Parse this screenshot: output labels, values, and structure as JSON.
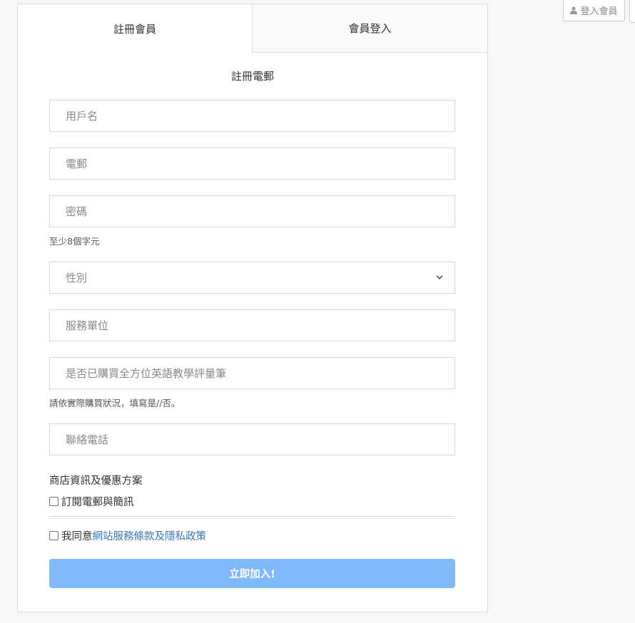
{
  "header": {
    "member_login_label": "登入會員"
  },
  "tabs": [
    {
      "label": "註冊會員",
      "active": true
    },
    {
      "label": "會員登入",
      "active": false
    }
  ],
  "form": {
    "heading": "註冊電郵",
    "username": {
      "placeholder": "用戶名",
      "value": ""
    },
    "email": {
      "placeholder": "電郵",
      "value": ""
    },
    "password": {
      "placeholder": "密碼",
      "value": "",
      "help": "至少8個字元"
    },
    "gender": {
      "selected": "性別",
      "icon": "chevron-down-icon"
    },
    "organization": {
      "placeholder": "服務單位",
      "value": ""
    },
    "purchased": {
      "placeholder": "是否已購買全方位英語教學評量筆",
      "value": "",
      "help": "請依實際購買狀況，填寫是//否。"
    },
    "phone": {
      "placeholder": "聯絡電話",
      "value": ""
    },
    "shop_section_label": "商店資訊及優惠方案",
    "subscribe_label": "訂閱電郵與簡訊",
    "agree_prefix": "我同意",
    "agree_link": "網站服務條款及隱私政策",
    "submit_label": "立即加入!"
  },
  "colors": {
    "submit_bg": "#80b9fa",
    "link": "#3a77b8",
    "page_bg": "#f7f7f7"
  }
}
